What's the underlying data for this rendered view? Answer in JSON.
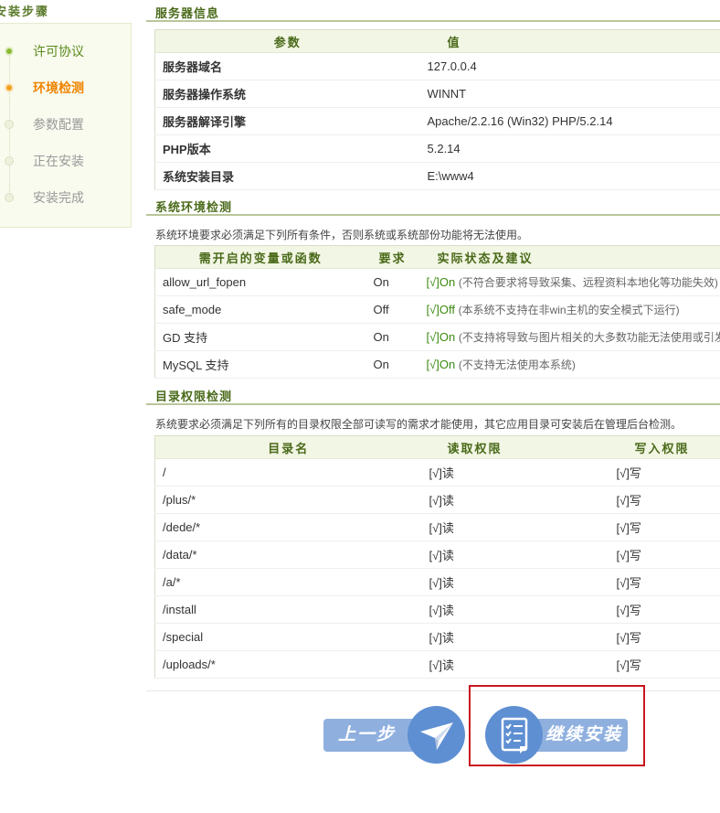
{
  "steps": {
    "title": "安装步骤",
    "items": [
      {
        "label": "许可协议",
        "state": "done"
      },
      {
        "label": "环境检测",
        "state": "current"
      },
      {
        "label": "参数配置",
        "state": "pending"
      },
      {
        "label": "正在安装",
        "state": "pending"
      },
      {
        "label": "安装完成",
        "state": "pending"
      }
    ]
  },
  "server": {
    "title": "服务器信息",
    "headers": [
      "参数",
      "值"
    ],
    "rows": [
      {
        "name": "服务器域名",
        "value": "127.0.0.4"
      },
      {
        "name": "服务器操作系统",
        "value": "WINNT"
      },
      {
        "name": "服务器解译引擎",
        "value": "Apache/2.2.16 (Win32) PHP/5.2.14"
      },
      {
        "name": "PHP版本",
        "value": "5.2.14"
      },
      {
        "name": "系统安装目录",
        "value": "E:\\www4"
      }
    ]
  },
  "env": {
    "title": "系统环境检测",
    "note": "系统环境要求必须满足下列所有条件，否则系统或系统部份功能将无法使用。",
    "headers": [
      "需开启的变量或函数",
      "要求",
      "实际状态及建议"
    ],
    "rows": [
      {
        "name": "allow_url_fopen",
        "req": "On",
        "status": "[√]On",
        "hint": "(不符合要求将导致采集、远程资料本地化等功能失效)"
      },
      {
        "name": "safe_mode",
        "req": "Off",
        "status": "[√]Off",
        "hint": "(本系统不支持在非win主机的安全模式下运行)"
      },
      {
        "name": "GD 支持",
        "req": "On",
        "status": "[√]On",
        "hint": "(不支持将导致与图片相关的大多数功能无法使用或引发警告)"
      },
      {
        "name": "MySQL 支持",
        "req": "On",
        "status": "[√]On",
        "hint": "(不支持无法使用本系统)"
      }
    ]
  },
  "dirs": {
    "title": "目录权限检测",
    "note": "系统要求必须满足下列所有的目录权限全部可读写的需求才能使用，其它应用目录可安装后在管理后台检测。",
    "headers": [
      "目录名",
      "读取权限",
      "写入权限"
    ],
    "rows": [
      {
        "name": "/",
        "read": "[√]读",
        "write": "[√]写"
      },
      {
        "name": "/plus/*",
        "read": "[√]读",
        "write": "[√]写"
      },
      {
        "name": "/dede/*",
        "read": "[√]读",
        "write": "[√]写"
      },
      {
        "name": "/data/*",
        "read": "[√]读",
        "write": "[√]写"
      },
      {
        "name": "/a/*",
        "read": "[√]读",
        "write": "[√]写"
      },
      {
        "name": "/install",
        "read": "[√]读",
        "write": "[√]写"
      },
      {
        "name": "/special",
        "read": "[√]读",
        "write": "[√]写"
      },
      {
        "name": "/uploads/*",
        "read": "[√]读",
        "write": "[√]写"
      }
    ]
  },
  "buttons": {
    "prev": "上一步",
    "next": "继续安装"
  },
  "colors": {
    "accent_green": "#4a6a1a",
    "ok_green": "#3d8a11",
    "current_orange": "#f08300",
    "button_blue": "#5e8fd2",
    "highlight_red": "#c8171e"
  }
}
